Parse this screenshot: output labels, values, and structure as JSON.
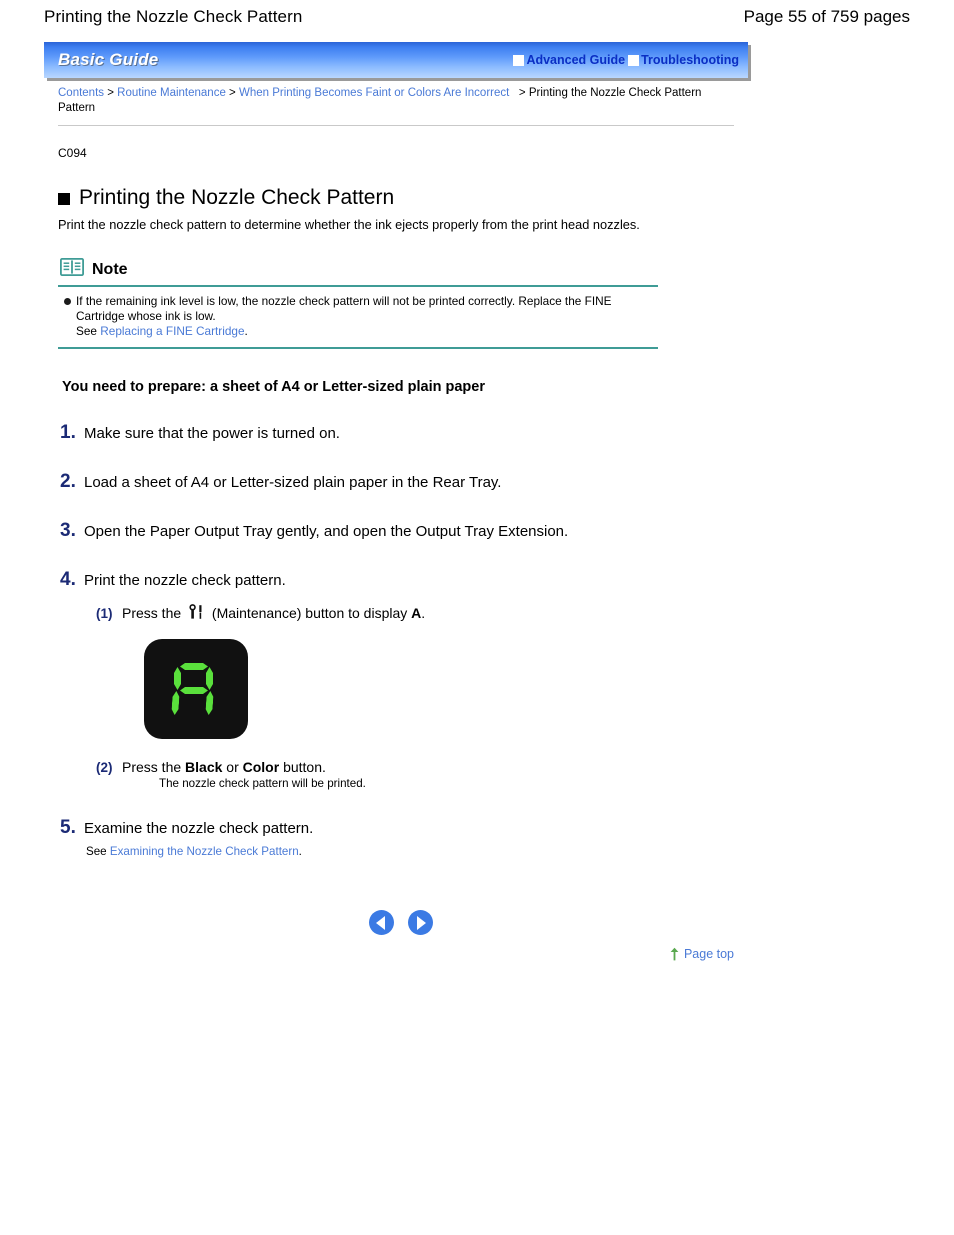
{
  "page_header": {
    "doc_title": "Printing the Nozzle Check Pattern",
    "page_count": "Page 55 of 759 pages"
  },
  "banner": {
    "title": "Basic Guide",
    "links": [
      {
        "label": "Advanced Guide",
        "icon": "white-square-icon"
      },
      {
        "label": "Troubleshooting",
        "icon": "white-square-icon"
      }
    ],
    "gradient_from": "#2a63d6",
    "gradient_to": "#b9d7ff"
  },
  "breadcrumb": {
    "items": [
      {
        "label": "Contents",
        "link": true
      },
      {
        "label": "Routine Maintenance",
        "link": true
      },
      {
        "label": "When Printing Becomes Faint or Colors Are Incorrect",
        "link": true
      },
      {
        "label": "Printing the Nozzle Check Pattern Pattern",
        "link": false
      }
    ],
    "separator": ">",
    "link_color": "#4a7ad6"
  },
  "document": {
    "code": "C094",
    "heading": "Printing the Nozzle Check Pattern",
    "intro": "Print the nozzle check pattern to determine whether the ink ejects properly from the print head nozzles."
  },
  "note": {
    "icon": "open-book-icon",
    "label": "Note",
    "rule_color": "#3f9c96",
    "bullet_text": "If the remaining ink level is low, the nozzle check pattern will not be printed correctly. Replace the FINE Cartridge whose ink is low.",
    "see_prefix": "See ",
    "see_link": "Replacing a FINE Cartridge",
    "see_suffix": "."
  },
  "prepare_line": "You need to prepare: a sheet of A4 or Letter-sized plain paper",
  "steps": [
    {
      "num": "1.",
      "text": "Make sure that the power is turned on."
    },
    {
      "num": "2.",
      "text": "Load a sheet of A4 or Letter-sized plain paper in the Rear Tray."
    },
    {
      "num": "3.",
      "text": "Open the Paper Output Tray gently, and open the Output Tray Extension."
    },
    {
      "num": "4.",
      "text": "Print the nozzle check pattern."
    },
    {
      "num": "5.",
      "text": "Examine the nozzle check pattern."
    }
  ],
  "substep_1": {
    "num": "(1)",
    "text_before_icon": "Press the ",
    "icon": "maintenance-button-icon",
    "text_after_icon": " (Maintenance) button to display ",
    "bold_letter": "A",
    "text_end": "."
  },
  "led_figure": {
    "character": "A",
    "segment_color": "#5ae03c",
    "background_color": "#111111"
  },
  "substep_2": {
    "num": "(2)",
    "text_before": "Press the ",
    "bold_1": "Black",
    "text_mid": " or ",
    "bold_2": "Color",
    "text_after": " button.",
    "sub_note": "The nozzle check pattern will be printed."
  },
  "step5_note": {
    "see_prefix": "See ",
    "see_link": "Examining the Nozzle Check Pattern",
    "see_suffix": "."
  },
  "nav": {
    "prev_label": "previous-page",
    "next_label": "next-page",
    "arrow_color": "#3b7ae4"
  },
  "page_top": {
    "icon": "up-arrow-icon",
    "label": "Page top",
    "icon_color": "#5aa84f"
  }
}
